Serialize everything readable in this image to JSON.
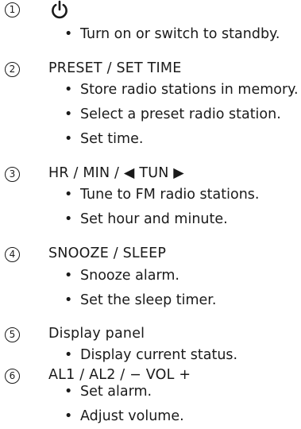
{
  "sections": [
    {
      "number": "1",
      "title": "",
      "icon": "power-icon",
      "bullets": [
        "Turn on or switch to standby."
      ]
    },
    {
      "number": "2",
      "title": "PRESET / SET TIME",
      "bullets": [
        "Store radio stations in memory.",
        "Select a preset radio station.",
        "Set time."
      ]
    },
    {
      "number": "3",
      "title": "HR / MIN / ◀ TUN ▶",
      "bullets": [
        "Tune to FM radio stations.",
        "Set hour and minute."
      ]
    },
    {
      "number": "4",
      "title": "SNOOZE / SLEEP",
      "bullets": [
        "Snooze alarm.",
        "Set the sleep timer."
      ]
    },
    {
      "number": "5",
      "title": "Display panel",
      "bullets": [
        "Display current status."
      ]
    },
    {
      "number": "6",
      "title": "AL1 / AL2 / − VOL +",
      "bullets": [
        "Set alarm.",
        "Adjust volume."
      ]
    }
  ]
}
